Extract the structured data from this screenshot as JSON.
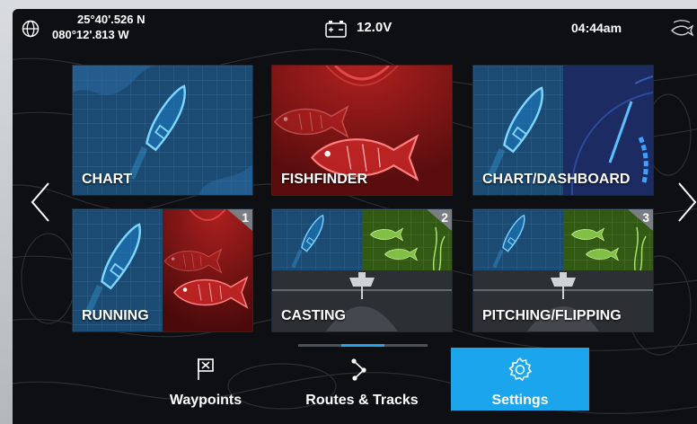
{
  "status": {
    "lat": "25°40'.526 N",
    "lon": "080°12'.813 W",
    "voltage": "12.0V",
    "time": "04:44am"
  },
  "tiles": [
    {
      "label": "CHART"
    },
    {
      "label": "FISHFINDER"
    },
    {
      "label": "CHART/DASHBOARD"
    },
    {
      "label": "RUNNING",
      "number": "1"
    },
    {
      "label": "CASTING",
      "number": "2"
    },
    {
      "label": "PITCHING/FLIPPING",
      "number": "3"
    }
  ],
  "nav": {
    "waypoints": "Waypoints",
    "routes": "Routes & Tracks",
    "settings": "Settings"
  },
  "pager": {
    "pages": 3,
    "current": 2
  },
  "colors": {
    "accent": "#1aa5ec",
    "chart_tile": "#1c4f78",
    "sonar_tile": "#8c1414",
    "sidevision_tile": "#3d6b12"
  },
  "icons": [
    "globe-icon",
    "battery-icon",
    "fish-icon",
    "boat-icon",
    "waypoint-flag-icon",
    "route-icon",
    "gear-icon",
    "chevron-left-icon",
    "chevron-right-icon"
  ]
}
